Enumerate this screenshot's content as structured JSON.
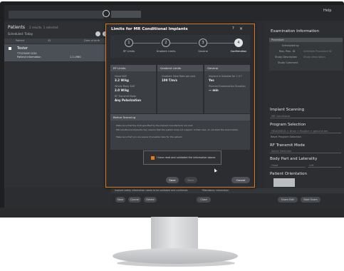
{
  "app": {
    "top_right": "Help",
    "patients": {
      "title": "Patients",
      "subtitle": "2 results, 1 selected",
      "schedule_label": "Scheduled: Today",
      "columns": [
        "Patient",
        "ID",
        "Date of birth"
      ],
      "row": {
        "name": "Tester",
        "id": "TT123456 1234",
        "line2": "Patient information",
        "dob": "1.1.1980"
      }
    }
  },
  "right_panel": {
    "title": "Examination Information",
    "procedure_header": "Procedure",
    "fields": [
      {
        "label": "Scheduled by",
        "value": ""
      },
      {
        "label": "Req. Proc. ID",
        "value": "Schedule Procedure ID"
      },
      {
        "label": "Study Description",
        "value": "Study description"
      },
      {
        "label": "Study Comment",
        "value": ""
      }
    ],
    "implant_scanning": {
      "title": "Implant Scanning",
      "value": "MR Conditional"
    },
    "program_selection": {
      "title": "Program Selection",
      "value": "HEAD/NECK > Brain > Routine > genuine bel",
      "option": "Reset Program Selection"
    },
    "rf_transmit": {
      "title": "RF Transmit Mode",
      "value": "Select Selection"
    },
    "body_part": {
      "title": "Body Part and Laterality",
      "value": "Head",
      "side": "Left"
    },
    "patient_orientation": {
      "title": "Patient Orientation"
    }
  },
  "dialog": {
    "title": "Limits for MR Conditional Implants",
    "help": "?",
    "close": "×",
    "steps": [
      {
        "num": "1",
        "label": "RF Limits"
      },
      {
        "num": "2",
        "label": "Gradient Limits"
      },
      {
        "num": "3",
        "label": "General"
      },
      {
        "num": "4",
        "label": "Confirmation"
      }
    ],
    "rf": {
      "header": "RF Limits",
      "l1": "Head SAR",
      "v1": "3.2 W/kg",
      "l2": "Whole Body SAR",
      "v2": "2.0 W/kg",
      "l3": "RF Transmit Mode",
      "v3": "Any Polarization"
    },
    "gradient": {
      "header": "Gradient Limits",
      "l1": "Gradient Slew Rate per axis",
      "v1": "100 T/m/s"
    },
    "general": {
      "header": "General",
      "l1": "Implant is Suitable for 1.5 T",
      "v1": "Yes",
      "l2": "Planned Examination Duration",
      "v2": "— min"
    },
    "scanning": {
      "header": "Before Scanning",
      "bullets": [
        "Make sure that the limit specified by the implant manufacturer are met.",
        "MR Conditional implants may require that the system does not support. In that case, do not start the examination.",
        "Make sure that you are aware of possible risks for the patient."
      ]
    },
    "confirm_text": "I have read and validated the information above.",
    "buttons": {
      "save": "Save",
      "back": "Back",
      "cancel": "Cancel"
    }
  },
  "bottom": {
    "warning": "Implant safety information needs to be validated and confirmed.",
    "warning2": "*Mandatory information",
    "buttons": [
      "Save",
      "Cancel",
      "Delete",
      "Close",
      "Exam Edit",
      "Start Exam"
    ]
  },
  "colors": {
    "accent": "#e07b1d",
    "bg": "#2b2d30"
  }
}
